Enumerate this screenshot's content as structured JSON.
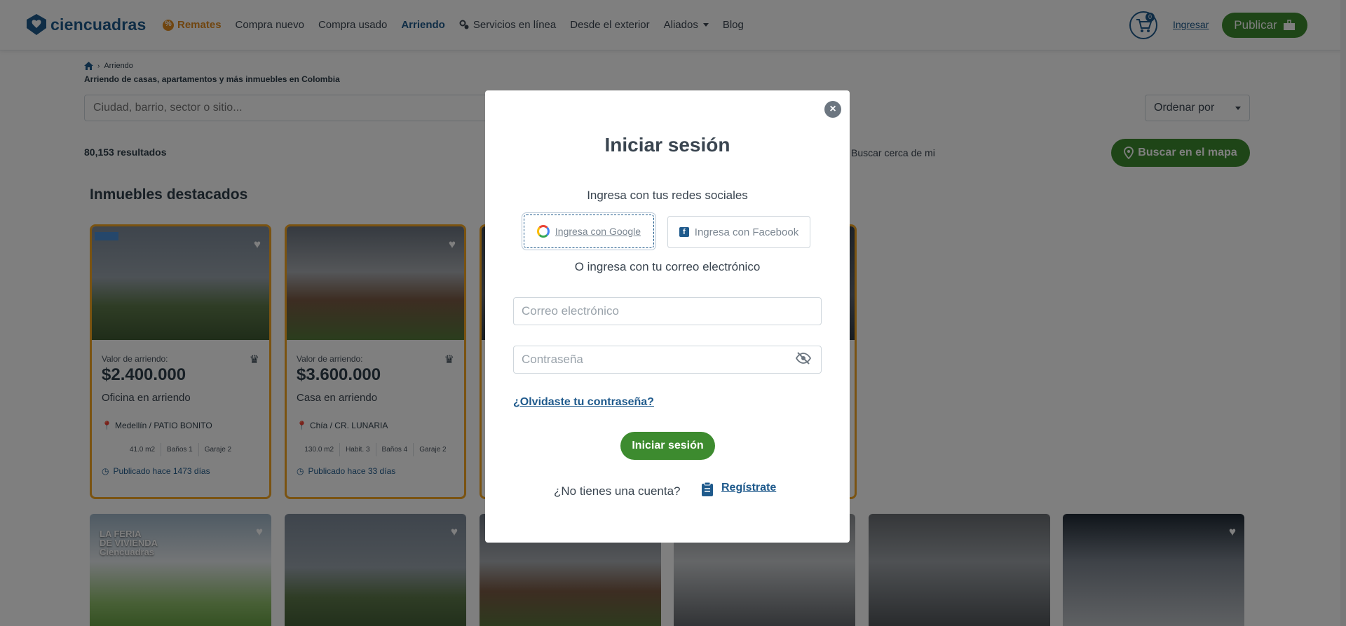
{
  "header": {
    "logo_text": "ciencuadras",
    "nav": {
      "remates": "Remates",
      "compra_nuevo": "Compra nuevo",
      "compra_usado": "Compra usado",
      "arriendo": "Arriendo",
      "servicios": "Servicios en línea",
      "exterior": "Desde el exterior",
      "aliados": "Aliados",
      "blog": "Blog"
    },
    "cart_count": "0",
    "ingresar": "Ingresar",
    "publicar": "Publicar"
  },
  "page": {
    "breadcrumb_current": "Arriendo",
    "subtitle": "Arriendo de casas, apartamentos y más inmuebles en Colombia",
    "search_placeholder": "Ciudad, barrio, sector o sitio...",
    "order_label": "Ordenar por",
    "results": "80,153 resultados",
    "near_me": "Buscar cerca de mi",
    "map_button": "Buscar en el mapa",
    "section_title": "Inmuebles destacados"
  },
  "cards": [
    {
      "price_label": "Valor de arriendo:",
      "price": "$2.400.000",
      "type": "Oficina en arriendo",
      "location": "Medellín / PATIO BONITO",
      "features": [
        "41.0 m2",
        "Baños 1",
        "Garaje 2"
      ],
      "published": "Publicado hace 1473 días"
    },
    {
      "price_label": "Valor de arriendo:",
      "price": "$3.600.000",
      "type": "Casa en arriendo",
      "location": "Chía / CR. LUNARIA",
      "features": [
        "130.0 m2",
        "Habit. 3",
        "Baños 4",
        "Garaje 2"
      ],
      "published": "Publicado hace 33 días"
    }
  ],
  "feria_badge": [
    "LA FERIA",
    "DE VIVIENDA",
    "Ciencuadras"
  ],
  "modal": {
    "title": "Iniciar sesión",
    "social_title": "Ingresa con tus redes sociales",
    "google": "Ingresa con Google",
    "facebook": "Ingresa con Facebook",
    "email_title": "O ingresa con tu correo electrónico",
    "email_placeholder": "Correo electrónico",
    "password_placeholder": "Contraseña",
    "forgot": "¿Olvidaste tu contraseña?",
    "login_button": "Iniciar sesión",
    "no_account": "¿No tienes una cuenta?",
    "register": "Regístrate"
  },
  "colors": {
    "brand_blue": "#1f5a8c",
    "brand_green": "#3d8b2f",
    "accent_orange": "#e08a1e",
    "featured_border": "#f5a623"
  }
}
